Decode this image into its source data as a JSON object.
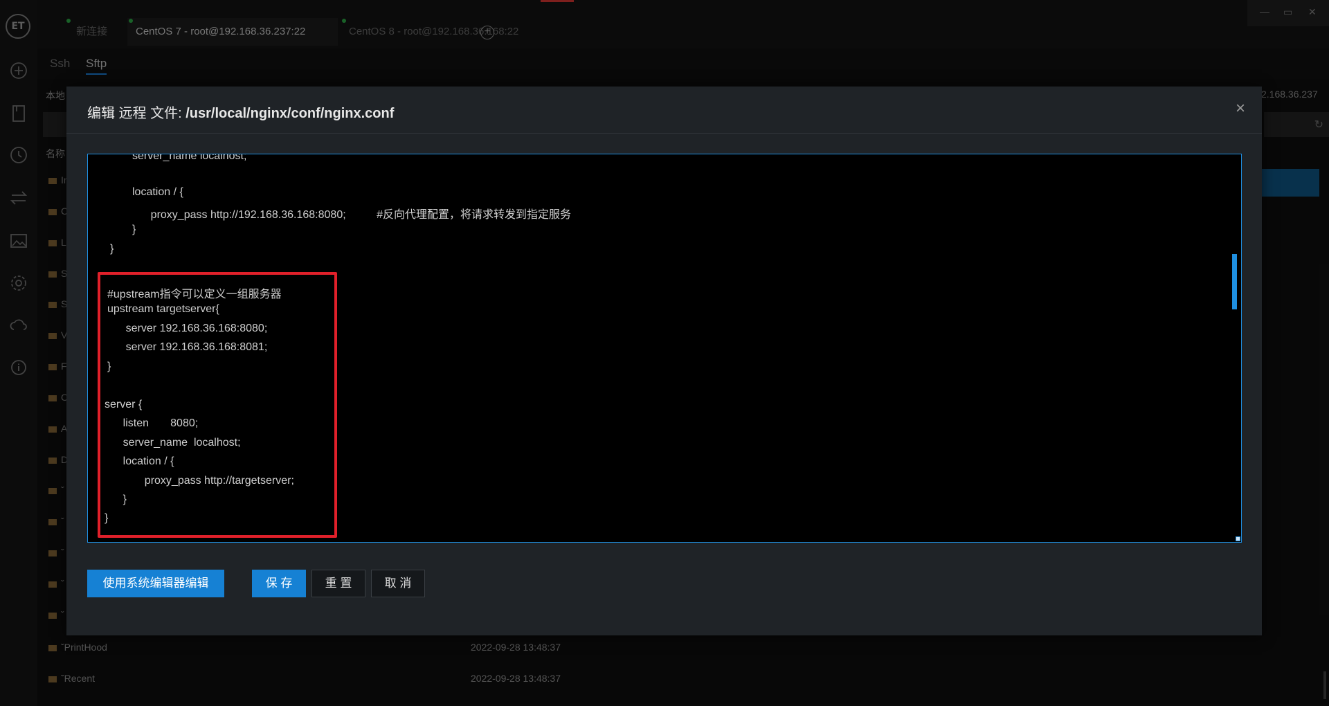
{
  "app": {
    "logo_text": "ET",
    "tabs": [
      {
        "label": "新连接",
        "active": false
      },
      {
        "label": "CentOS 7 - root@192.168.36.237:22",
        "active": true
      },
      {
        "label": "CentOS 8 - root@192.168.36.168:22",
        "active": false
      }
    ],
    "window_controls": {
      "minimize": "—",
      "maximize": "▭",
      "close": "✕"
    },
    "subtabs": [
      {
        "label": "Ssh",
        "active": false
      },
      {
        "label": "Sftp",
        "active": true
      }
    ]
  },
  "background_pane": {
    "left_label": "本地",
    "right_host_label": "2.168.36.237",
    "name_column": "名称",
    "rows": [
      {
        "name": "In",
        "date": ""
      },
      {
        "name": "C",
        "date": ""
      },
      {
        "name": "Li",
        "date": ""
      },
      {
        "name": "S",
        "date": ""
      },
      {
        "name": "S",
        "date": ""
      },
      {
        "name": "V",
        "date": ""
      },
      {
        "name": "F",
        "date": ""
      },
      {
        "name": "C",
        "date": ""
      },
      {
        "name": "A",
        "date": ""
      },
      {
        "name": "D",
        "date": ""
      },
      {
        "name": "ˇ",
        "date": ""
      },
      {
        "name": "ˇ",
        "date": ""
      },
      {
        "name": "ˇ",
        "date": ""
      },
      {
        "name": "ˇ",
        "date": ""
      },
      {
        "name": "ˇ",
        "date": ""
      },
      {
        "name": "ˇPrintHood",
        "date": "2022-09-28 13:48:37"
      },
      {
        "name": "ˇRecent",
        "date": "2022-09-28 13:48:37"
      }
    ]
  },
  "modal": {
    "title_prefix": "编辑 远程 文件: ",
    "title_path": "/usr/local/nginx/conf/nginx.conf",
    "close_icon": "×",
    "code_lines": [
      "server_name localhost;",
      "",
      "location / {",
      "      proxy_pass http://192.168.36.168:8080;          #反向代理配置，将请求转发到指定服务",
      "}",
      "}",
      "",
      "#upstream指令可以定义一组服务器",
      "upstream targetserver{",
      "      server 192.168.36.168:8080;",
      "      server 192.168.36.168:8081;",
      "}",
      "",
      "server {",
      "      listen       8080;",
      "      server_name  localhost;",
      "      location / {",
      "             proxy_pass http://targetserver;",
      "      }",
      "}"
    ],
    "buttons": {
      "system_editor": "使用系统编辑器编辑",
      "save": "保 存",
      "reset": "重 置",
      "cancel": "取 消"
    }
  },
  "colors": {
    "accent": "#1681d4",
    "highlight": "#e0202a",
    "connected_dot": "#2fb34a"
  }
}
